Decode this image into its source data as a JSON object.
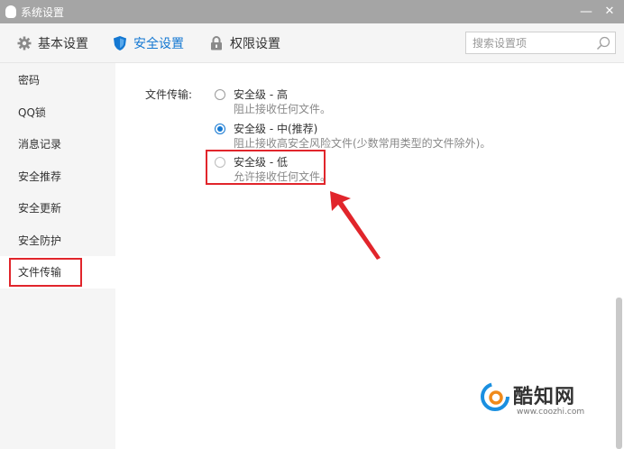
{
  "window": {
    "title": "系统设置",
    "minimize_label": "—",
    "close_label": "✕"
  },
  "toolbar": {
    "tabs": [
      {
        "label": "基本设置",
        "icon": "gear-icon",
        "active": false
      },
      {
        "label": "安全设置",
        "icon": "shield-icon",
        "active": true
      },
      {
        "label": "权限设置",
        "icon": "lock-icon",
        "active": false
      }
    ],
    "search": {
      "placeholder": "搜索设置项",
      "value": "",
      "icon": "search-icon"
    }
  },
  "sidebar": {
    "items": [
      {
        "label": "密码",
        "active": false
      },
      {
        "label": "QQ锁",
        "active": false
      },
      {
        "label": "消息记录",
        "active": false
      },
      {
        "label": "安全推荐",
        "active": false
      },
      {
        "label": "安全更新",
        "active": false
      },
      {
        "label": "安全防护",
        "active": false
      },
      {
        "label": "文件传输",
        "active": true
      }
    ]
  },
  "main": {
    "field_label": "文件传输:",
    "options": [
      {
        "name": "安全级 - 高",
        "desc": "阻止接收任何文件。",
        "selected": false
      },
      {
        "name": "安全级 - 中(推荐)",
        "desc": "阻止接收高安全风险文件(少数常用类型的文件除外)。",
        "selected": true
      },
      {
        "name": "安全级 - 低",
        "desc": "允许接收任何文件。",
        "selected": false
      }
    ]
  },
  "watermark": {
    "text": "酷知网",
    "url": "www.coozhi.com"
  },
  "colors": {
    "accent": "#1478d2",
    "highlight": "#e1252b",
    "titlebar": "#a5a5a5",
    "panel": "#f5f5f5"
  }
}
